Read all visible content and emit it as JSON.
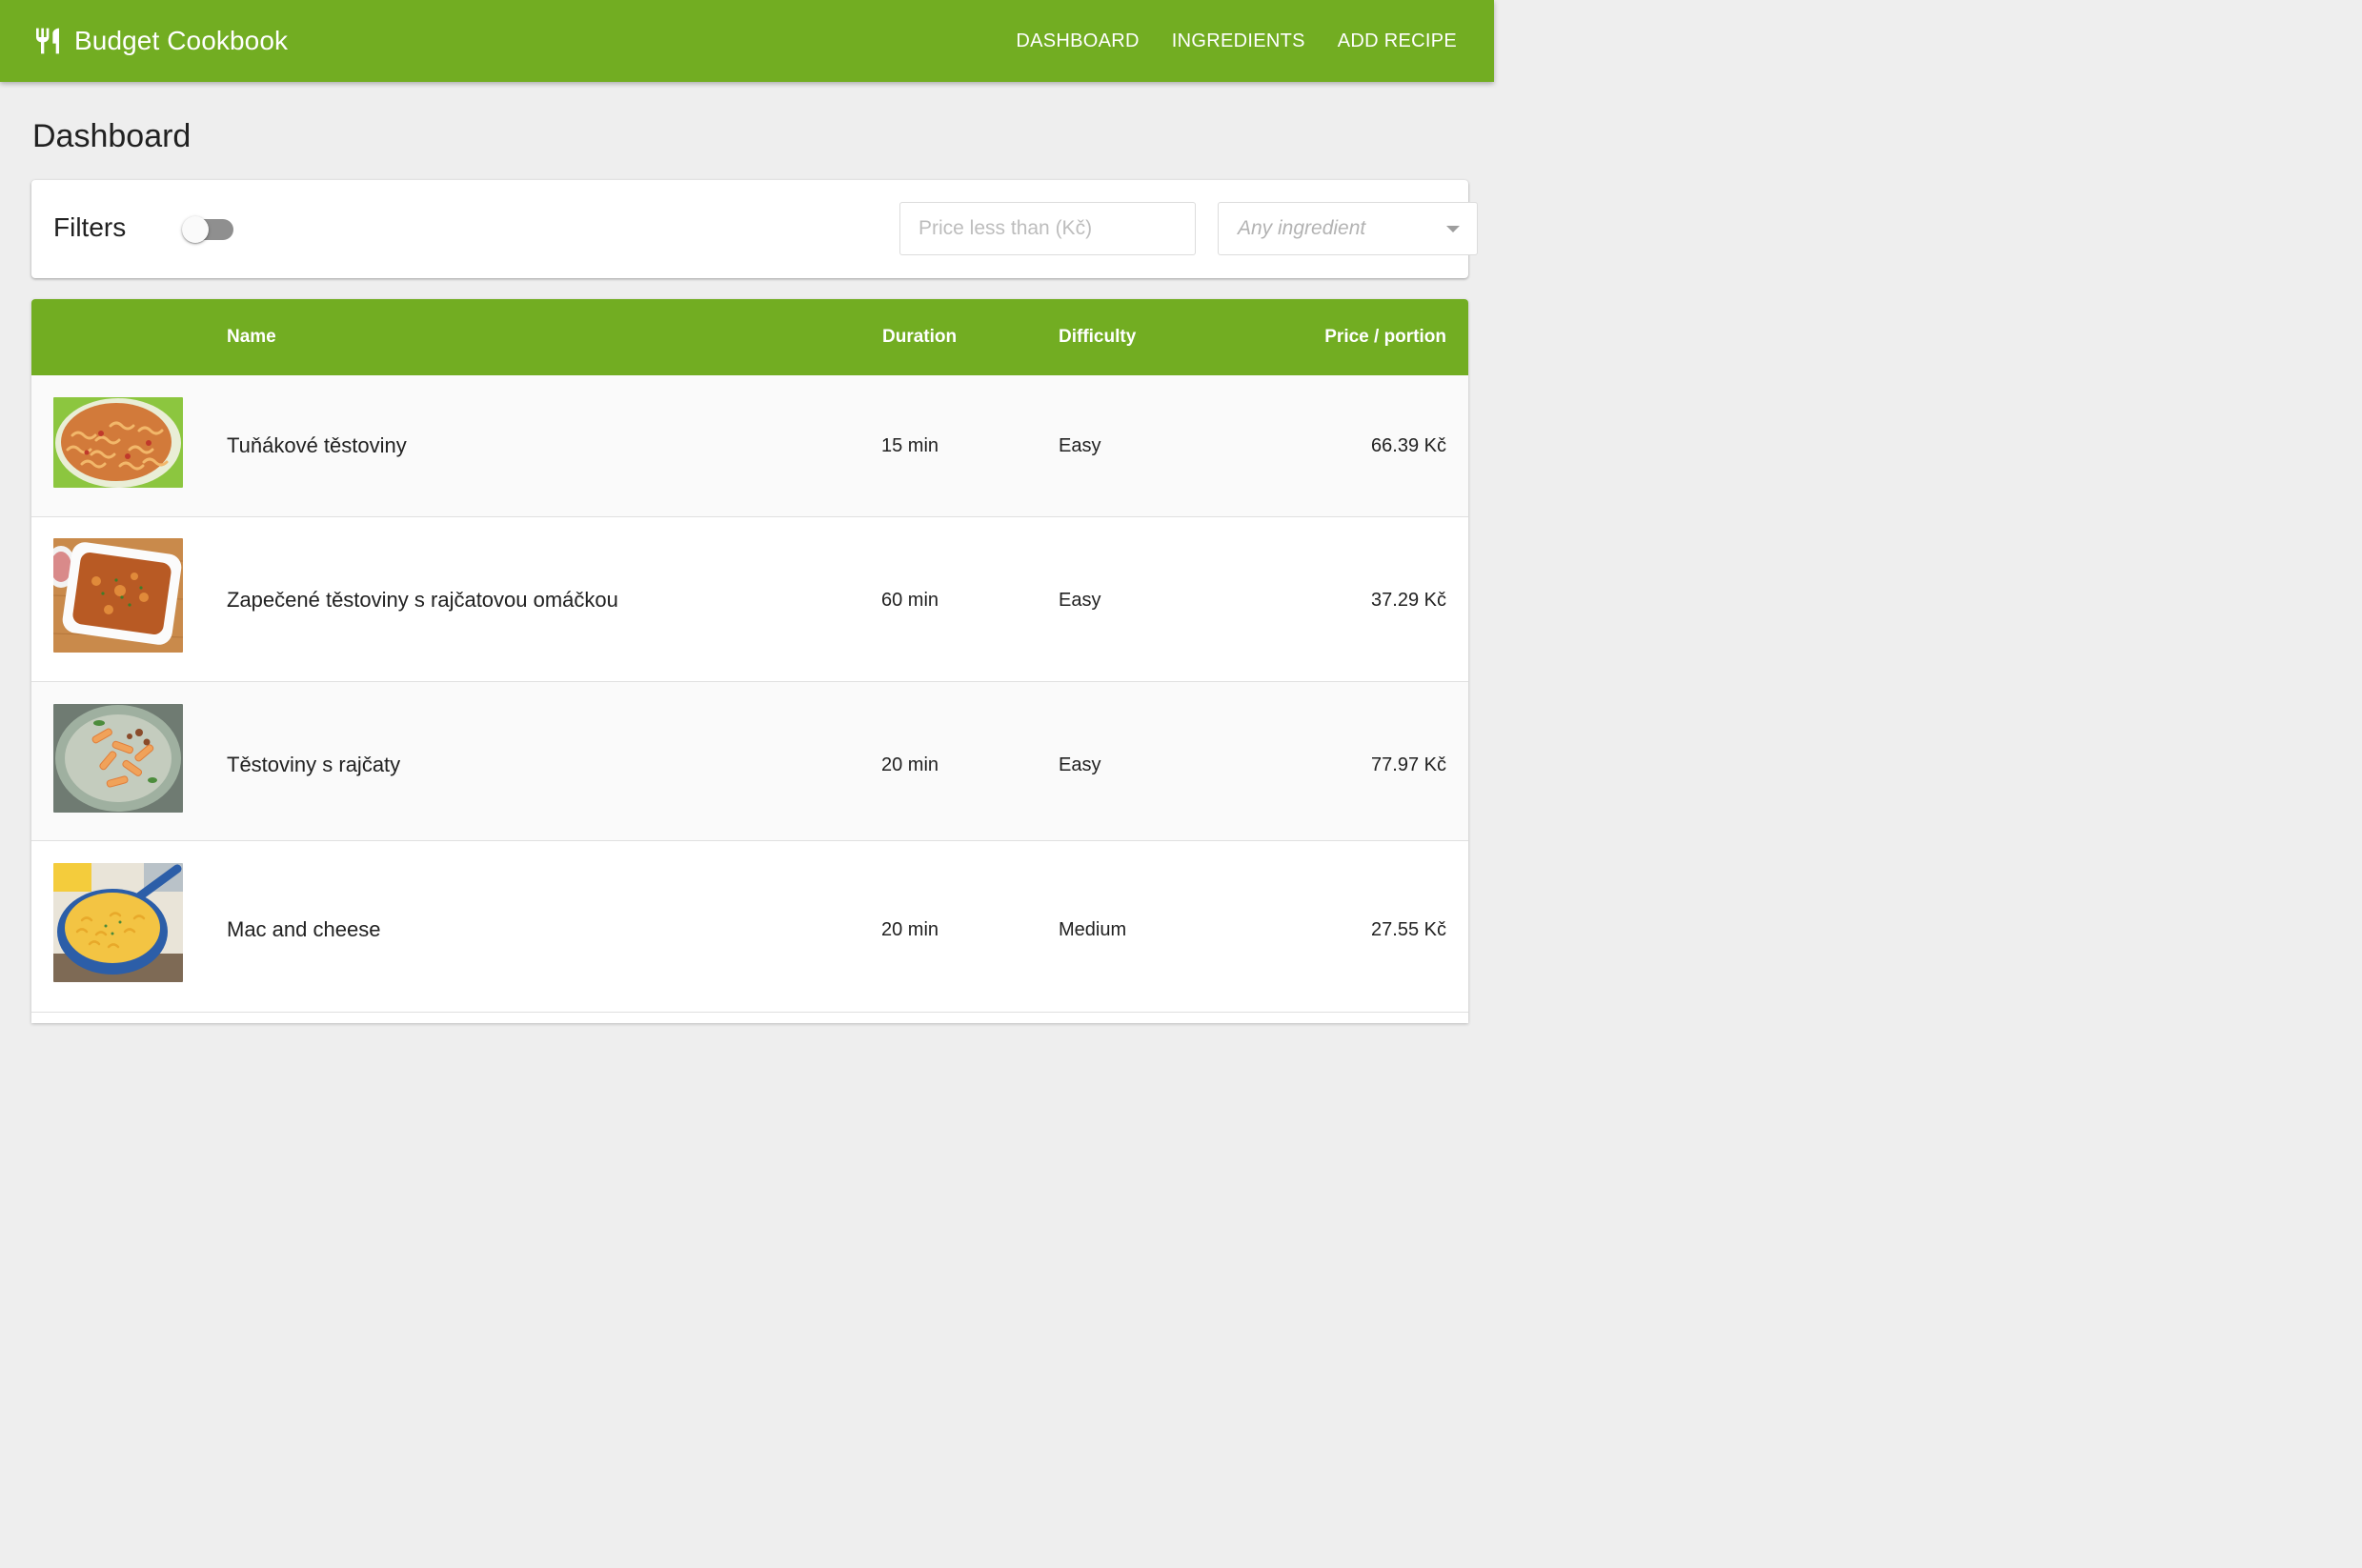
{
  "app": {
    "title": "Budget Cookbook",
    "brand_icon": "fork-knife-icon",
    "accent_color": "#72ad22"
  },
  "nav": {
    "items": [
      {
        "label": "DASHBOARD"
      },
      {
        "label": "INGREDIENTS"
      },
      {
        "label": "ADD RECIPE"
      }
    ]
  },
  "page": {
    "title": "Dashboard"
  },
  "filters": {
    "label": "Filters",
    "enabled": false,
    "price": {
      "placeholder": "Price less than (Kč)",
      "value": ""
    },
    "ingredient": {
      "selected": "Any ingredient"
    }
  },
  "table": {
    "columns": {
      "name": "Name",
      "duration": "Duration",
      "difficulty": "Difficulty",
      "price": "Price / portion"
    },
    "rows": [
      {
        "name": "Tuňákové těstoviny",
        "duration": "15 min",
        "difficulty": "Easy",
        "price": "66.39 Kč",
        "image": "fusilli-tuna-photo"
      },
      {
        "name": "Zapečené těstoviny s rajčatovou omáčkou",
        "duration": "60 min",
        "difficulty": "Easy",
        "price": "37.29 Kč",
        "image": "baked-pasta-photo"
      },
      {
        "name": "Těstoviny s rajčaty",
        "duration": "20 min",
        "difficulty": "Easy",
        "price": "77.97 Kč",
        "image": "penne-tomato-photo"
      },
      {
        "name": "Mac and cheese",
        "duration": "20 min",
        "difficulty": "Medium",
        "price": "27.55 Kč",
        "image": "mac-and-cheese-photo"
      }
    ]
  }
}
